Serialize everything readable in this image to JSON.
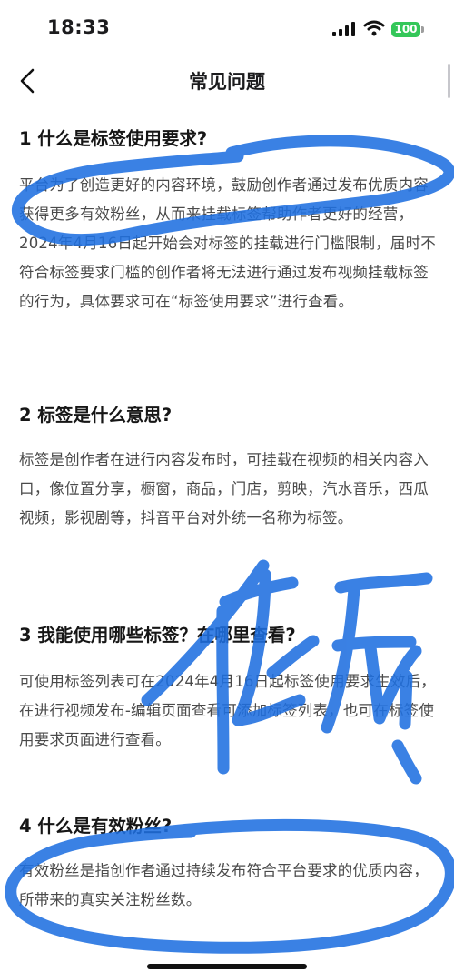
{
  "status_bar": {
    "time": "18:33",
    "battery": "100"
  },
  "nav": {
    "title": "常见问题"
  },
  "faq": [
    {
      "question": "1 什么是标签使用要求?",
      "answer": "平台为了创造更好的内容环境，鼓励创作者通过发布优质内容获得更多有效粉丝，从而来挂载标签帮助作者更好的经营，2024年4月16日起开始会对标签的挂载进行门槛限制，届时不符合标签要求门槛的创作者将无法进行通过发布视频挂载标签的行为，具体要求可在“标签使用要求”进行查看。"
    },
    {
      "question": "2 标签是什么意思?",
      "answer": "标签是创作者在进行内容发布时，可挂载在视频的相关内容入口，像位置分享，橱窗，商品，门店，剪映，汽水音乐，西瓜视频，影视剧等，抖音平台对外统一名称为标签。"
    },
    {
      "question": "3 我能使用哪些标签？在哪里查看?",
      "answer": "可使用标签列表可在2024年4月16日起标签使用要求生效后，在进行视频发布-编辑页面查看可添加标签列表，也可在标签使用要求页面进行查看。"
    },
    {
      "question": "4 什么是有效粉丝?",
      "answer": "有效粉丝是指创作者通过持续发布符合平台要求的优质内容，所带来的真实关注粉丝数。"
    }
  ],
  "colors": {
    "scribble": "#1f6fe0",
    "battery": "#34c759"
  },
  "icons": [
    "signal-icon",
    "wifi-icon",
    "back-chevron-icon"
  ]
}
